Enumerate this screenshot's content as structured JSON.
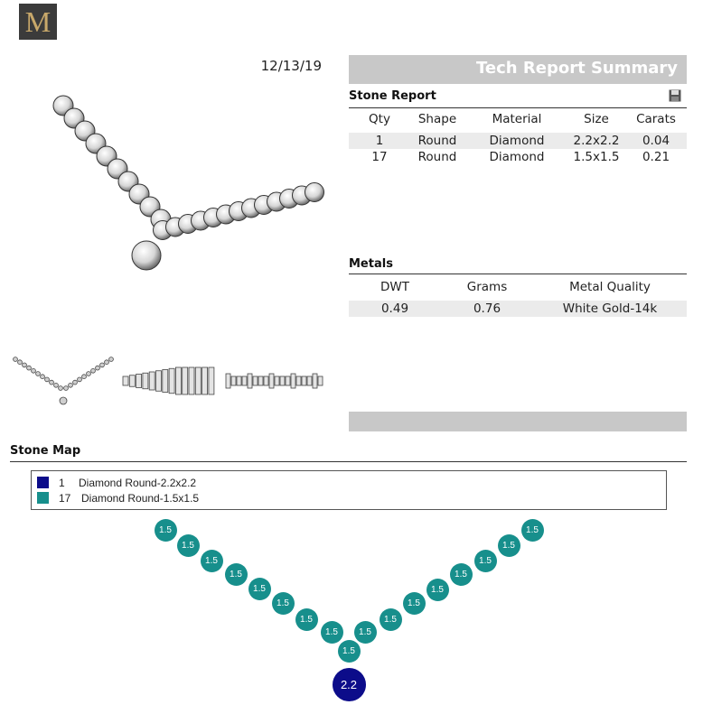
{
  "header": {
    "logo_letter": "M",
    "date": "12/13/19",
    "title": "Tech Report Summary"
  },
  "stone_report": {
    "title": "Stone Report",
    "save_icon": "save-icon",
    "columns": [
      "Qty",
      "Shape",
      "Material",
      "Size",
      "Carats"
    ],
    "rows": [
      [
        "1",
        "Round",
        "Diamond",
        "2.2x2.2",
        "0.04"
      ],
      [
        "17",
        "Round",
        "Diamond",
        "1.5x1.5",
        "0.21"
      ]
    ]
  },
  "metals": {
    "title": "Metals",
    "columns": [
      "DWT",
      "Grams",
      "Metal Quality"
    ],
    "rows": [
      [
        "0.49",
        "0.76",
        "White Gold-14k"
      ]
    ]
  },
  "stone_map": {
    "title": "Stone Map",
    "legend": [
      {
        "count": "1",
        "label": "Diamond Round-2.2x2.2",
        "color": "#0c0c8a"
      },
      {
        "count": "17",
        "label": "Diamond Round-1.5x1.5",
        "color": "#178f8c"
      }
    ],
    "small_label": "1.5",
    "big_label": "2.2",
    "colors": {
      "small": "#178f8c",
      "big": "#0c0c8a"
    }
  }
}
